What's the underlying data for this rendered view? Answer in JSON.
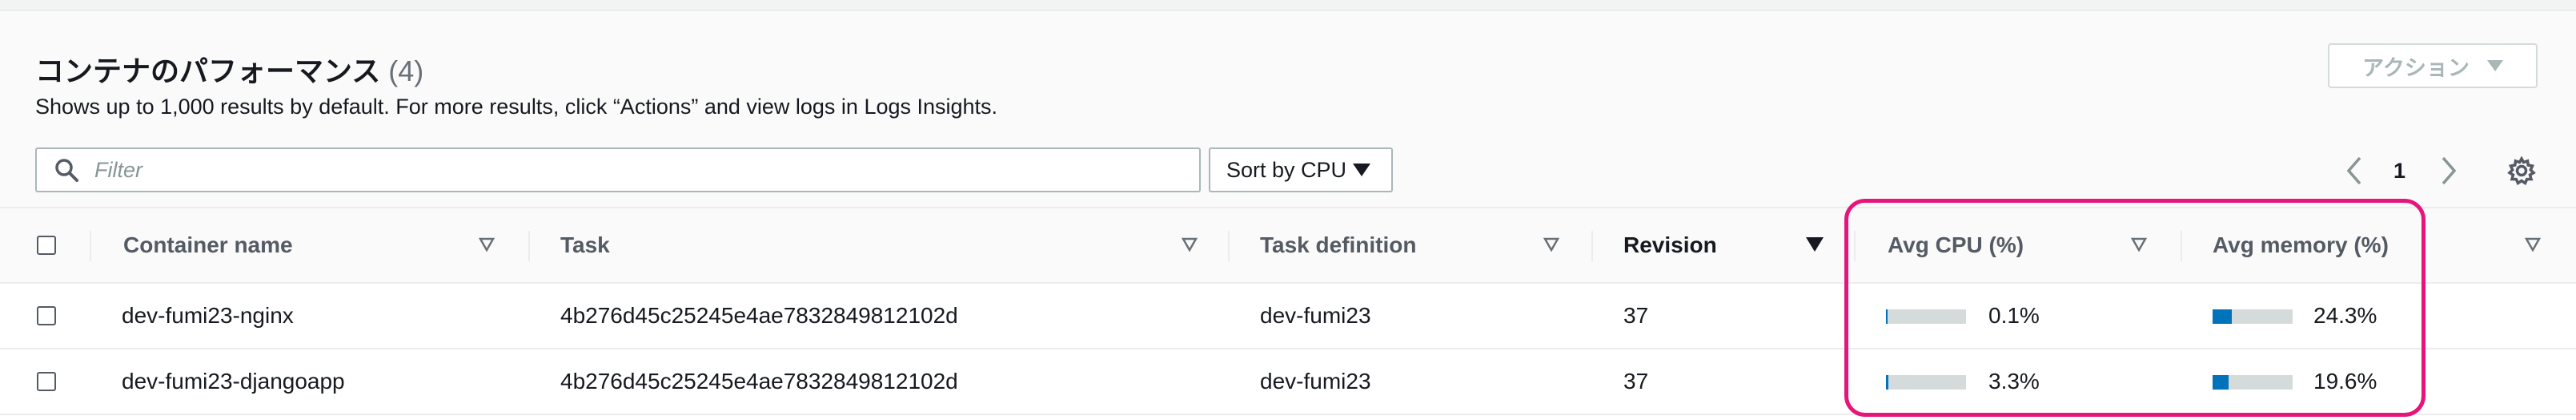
{
  "header": {
    "title": "コンテナのパフォーマンス",
    "count": "(4)",
    "description": "Shows up to 1,000 results by default. For more results, click “Actions” and view logs in Logs Insights.",
    "actions_label": "アクション"
  },
  "toolbar": {
    "filter_placeholder": "Filter",
    "sort_label": "Sort by CPU",
    "page_number": "1"
  },
  "table": {
    "columns": [
      "Container name",
      "Task",
      "Task definition",
      "Revision",
      "Avg CPU (%)",
      "Avg memory (%)"
    ],
    "sorted_column": "Revision",
    "rows": [
      {
        "container_name": "dev-fumi23-nginx",
        "task": "4b276d45c25245e4ae7832849812102d",
        "task_definition": "dev-fumi23",
        "revision": "37",
        "avg_cpu": "0.1%",
        "avg_cpu_value": 0.1,
        "avg_memory": "24.3%",
        "avg_memory_value": 24.3
      },
      {
        "container_name": "dev-fumi23-djangoapp",
        "task": "4b276d45c25245e4ae7832849812102d",
        "task_definition": "dev-fumi23",
        "revision": "37",
        "avg_cpu": "3.3%",
        "avg_cpu_value": 3.3,
        "avg_memory": "19.6%",
        "avg_memory_value": 19.6
      }
    ]
  },
  "colors": {
    "bar_fill": "#0073bb",
    "bar_track": "#d5dbdb",
    "highlight": "#e7157b"
  }
}
